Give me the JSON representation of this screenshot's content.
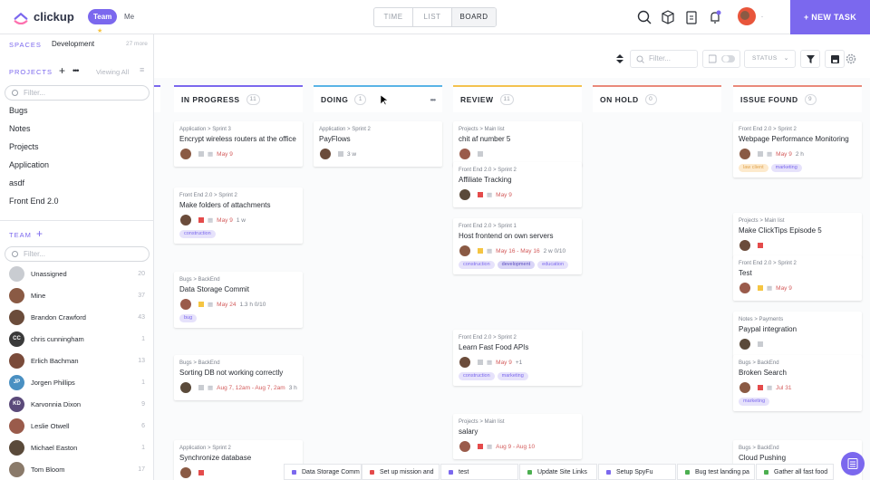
{
  "header": {
    "logo_text": "clickup",
    "workspace_team": "Team",
    "workspace_me": "Me",
    "view_tabs": [
      "TIME",
      "LIST",
      "BOARD"
    ],
    "new_task_label": "+ NEW TASK"
  },
  "sidebar": {
    "spaces_label": "SPACES",
    "space_name": "Development",
    "spaces_more": "27 more",
    "projects_label": "PROJECTS",
    "viewing_all": "Viewing All",
    "filter_placeholder": "Filter...",
    "projects": [
      "Bugs",
      "Notes",
      "Projects",
      "Application",
      "asdf",
      "Front End 2.0"
    ],
    "team_label": "TEAM",
    "team_filter_placeholder": "Filter...",
    "members": [
      {
        "name": "Unassigned",
        "count": "20",
        "color": "#c9ccd1",
        "initials": ""
      },
      {
        "name": "Mine",
        "count": "37",
        "color": "#8a5a44",
        "initials": ""
      },
      {
        "name": "Brandon Crawford",
        "count": "43",
        "color": "#6b4c3b",
        "initials": ""
      },
      {
        "name": "chris cunningham",
        "count": "1",
        "color": "#3a3a3a",
        "initials": "CC"
      },
      {
        "name": "Erlich Bachman",
        "count": "13",
        "color": "#7a4b3a",
        "initials": ""
      },
      {
        "name": "Jorgen Phillips",
        "count": "1",
        "color": "#4a90c2",
        "initials": "JP"
      },
      {
        "name": "Karvonnia Dixon",
        "count": "9",
        "color": "#5b4a7a",
        "initials": "KD"
      },
      {
        "name": "Leslie Otwell",
        "count": "6",
        "color": "#9a5b4b",
        "initials": ""
      },
      {
        "name": "Michael Easton",
        "count": "1",
        "color": "#5a4a3a",
        "initials": ""
      },
      {
        "name": "Tom Bloom",
        "count": "17",
        "color": "#8a7a6a",
        "initials": ""
      }
    ]
  },
  "toolbar": {
    "filter_placeholder": "Filter...",
    "status_label": "STATUS"
  },
  "columns": [
    {
      "name": "IN PROGRESS",
      "count": "11",
      "color": "#7b68ee",
      "cards": [
        {
          "crumb": "Application > Sprint 3",
          "title": "Encrypt wireless routers at the office",
          "date": "May 9",
          "extra": "",
          "tags": []
        },
        {
          "crumb": "Front End 2.0 > Sprint 2",
          "title": "Make folders of attachments",
          "date": "May 9",
          "extra": "1 w",
          "tags": [
            {
              "text": "construction",
              "style": "purple"
            }
          ]
        },
        {
          "crumb": "Bugs > BackEnd",
          "title": "Data Storage Commit",
          "date": "May 24",
          "extra": "1.3 h  0/10",
          "tags": [
            {
              "text": "bug",
              "style": "purple"
            }
          ]
        },
        {
          "crumb": "Bugs > BackEnd",
          "title": "Sorting DB not working correctly",
          "date": "Aug 7, 12am - Aug 7, 2am",
          "extra": "3 h",
          "tags": []
        },
        {
          "crumb": "Application > Sprint 2",
          "title": "Synchronize database",
          "date": "",
          "extra": "",
          "tags": []
        }
      ]
    },
    {
      "name": "DOING",
      "count": "1",
      "color": "#5ab4e6",
      "cards": [
        {
          "crumb": "Application > Sprint 2",
          "title": "PayFlows",
          "date": "",
          "extra": "3 w",
          "tags": []
        }
      ]
    },
    {
      "name": "REVIEW",
      "count": "11",
      "color": "#f3c24f",
      "cards": [
        {
          "crumb": "Projects > Main list",
          "title": "chit af number 5",
          "date": "",
          "extra": "",
          "tags": []
        },
        {
          "crumb": "Front End 2.0 > Sprint 2",
          "title": "Affiliate Tracking",
          "date": "May 9",
          "extra": "",
          "tags": []
        },
        {
          "crumb": "Front End 2.0 > Sprint 1",
          "title": "Host frontend on own servers",
          "date": "May 16 - May 16",
          "extra": "2 w  0/10",
          "tags": [
            {
              "text": "construction",
              "style": "purple"
            },
            {
              "text": "development",
              "style": "blue"
            },
            {
              "text": "education",
              "style": "purple"
            }
          ]
        },
        {
          "crumb": "Front End 2.0 > Sprint 2",
          "title": "Learn Fast Food APIs",
          "date": "May 9",
          "extra": "+1",
          "tags": [
            {
              "text": "construction",
              "style": "purple"
            },
            {
              "text": "marketing",
              "style": "purple"
            }
          ]
        },
        {
          "crumb": "Projects > Main list",
          "title": "salary",
          "date": "Aug 9 - Aug 10",
          "extra": "",
          "tags": []
        }
      ]
    },
    {
      "name": "ON HOLD",
      "count": "0",
      "color": "#e9897b",
      "cards": []
    },
    {
      "name": "ISSUE FOUND",
      "count": "9",
      "color": "#e9897b",
      "cards": [
        {
          "crumb": "Front End 2.0 > Sprint 2",
          "title": "Webpage Performance Monitoring",
          "date": "May 9",
          "extra": "2 h",
          "tags": [
            {
              "text": "law client",
              "style": "orange"
            },
            {
              "text": "marketing",
              "style": "purple"
            }
          ]
        },
        {
          "crumb": "Projects > Main list",
          "title": "Make ClickTips Episode 5",
          "date": "",
          "extra": "",
          "tags": []
        },
        {
          "crumb": "Front End 2.0 > Sprint 2",
          "title": "Test",
          "date": "May 9",
          "extra": "",
          "tags": []
        },
        {
          "crumb": "Notes > Payments",
          "title": "Paypal integration",
          "date": "",
          "extra": "",
          "tags": []
        },
        {
          "crumb": "Bugs > BackEnd",
          "title": "Broken Search",
          "date": "Jul 31",
          "extra": "",
          "tags": [
            {
              "text": "marketing",
              "style": "purple"
            }
          ]
        },
        {
          "crumb": "Bugs > BackEnd",
          "title": "Cloud Pushing",
          "date": "",
          "extra": "",
          "tags": []
        }
      ]
    }
  ],
  "tray": [
    {
      "label": "Data Storage Comm",
      "color": "#7b68ee"
    },
    {
      "label": "Set up mission and",
      "color": "#e44b4b"
    },
    {
      "label": "test",
      "color": "#7b68ee"
    },
    {
      "label": "Update Site Links",
      "color": "#4caf50"
    },
    {
      "label": "Setup SpyFu",
      "color": "#7b68ee"
    },
    {
      "label": "Bug test landing pa",
      "color": "#4caf50"
    },
    {
      "label": "Gather all fast food",
      "color": "#4caf50"
    }
  ]
}
